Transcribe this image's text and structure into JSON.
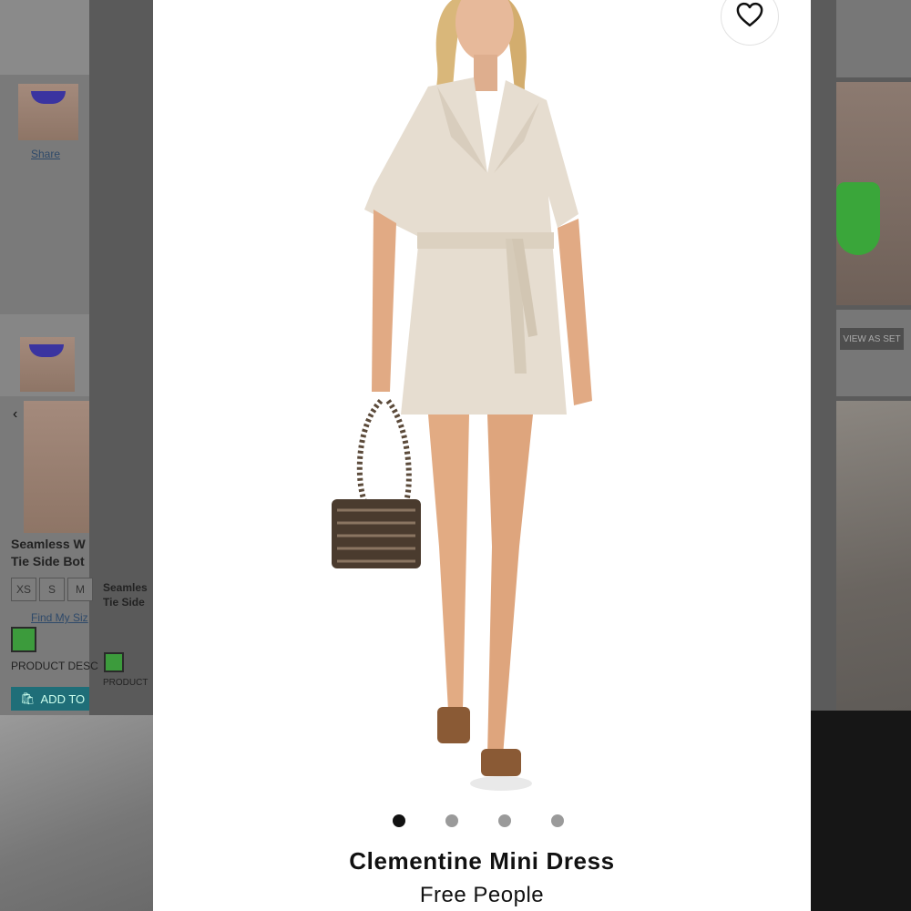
{
  "background_page": {
    "left": {
      "share_label": "Share",
      "product_name_line1": "Seamless W",
      "product_name_line2": "Tie Side Bot",
      "sizes": [
        "XS",
        "S",
        "M"
      ],
      "find_size_link": "Find My Siz",
      "product_desc_label": "PRODUCT DESC",
      "add_to_bag_label": "ADD TO",
      "second_name_line1": "Seamles",
      "second_name_line2": "Tie Side",
      "second_desc_label": "PRODUCT",
      "swatch_color": "#3c9b3c"
    },
    "right": {
      "view_as_set_label": "VIEW AS SET"
    }
  },
  "modal": {
    "favorite_icon": "heart-outline-icon",
    "carousel": {
      "total": 4,
      "active_index": 0
    },
    "product_title": "Clementine Mini Dress",
    "brand": "Free People"
  }
}
